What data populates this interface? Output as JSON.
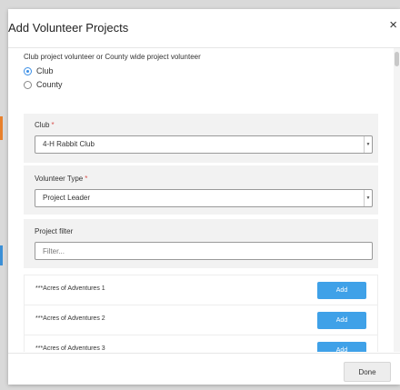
{
  "dialog": {
    "title": "Add Volunteer Projects",
    "close_glyph": "×"
  },
  "scope": {
    "question": "Club project volunteer or County wide project volunteer",
    "options": [
      {
        "label": "Club",
        "selected": true
      },
      {
        "label": "County",
        "selected": false
      }
    ]
  },
  "club": {
    "label": "Club",
    "required_mark": "*",
    "value": "4-H Rabbit Club"
  },
  "volunteer_type": {
    "label": "Volunteer Type",
    "required_mark": "*",
    "value": "Project Leader"
  },
  "project_filter": {
    "label": "Project filter",
    "placeholder": "Filter..."
  },
  "projects": [
    {
      "name": "***Acres of Adventures 1",
      "button": "Add"
    },
    {
      "name": "***Acres of Adventures 2",
      "button": "Add"
    },
    {
      "name": "***Acres of Adventures 3",
      "button": "Add"
    }
  ],
  "footer": {
    "done_label": "Done"
  },
  "colors": {
    "accent": "#3fa1e8",
    "required": "#d9534f"
  }
}
